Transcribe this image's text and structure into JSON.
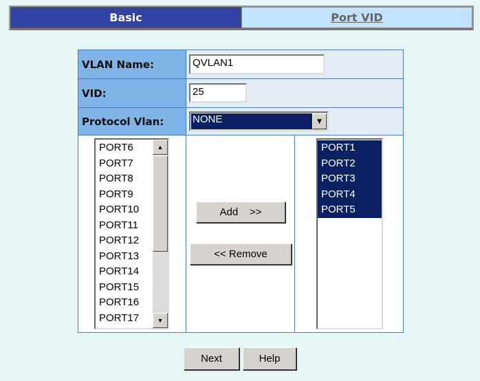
{
  "tabs": [
    {
      "label": "Basic",
      "active": true
    },
    {
      "label": "Port VID",
      "active": false
    }
  ],
  "form": {
    "vlan_name_label": "VLAN Name:",
    "vlan_name_value": "QVLAN1",
    "vid_label": "VID:",
    "vid_value": "25",
    "protocol_label": "Protocol Vlan:",
    "protocol_value": "NONE"
  },
  "available_ports": [
    "PORT6",
    "PORT7",
    "PORT8",
    "PORT9",
    "PORT10",
    "PORT11",
    "PORT12",
    "PORT13",
    "PORT14",
    "PORT15",
    "PORT16",
    "PORT17"
  ],
  "member_ports": [
    "PORT1",
    "PORT2",
    "PORT3",
    "PORT4",
    "PORT5"
  ],
  "buttons": {
    "add": "Add    >>",
    "remove": "<< Remove",
    "next": "Next",
    "help": "Help"
  },
  "colors": {
    "active_tab": "#3242a2",
    "selection": "#0a2060",
    "label_bg": "#80b4e6"
  }
}
